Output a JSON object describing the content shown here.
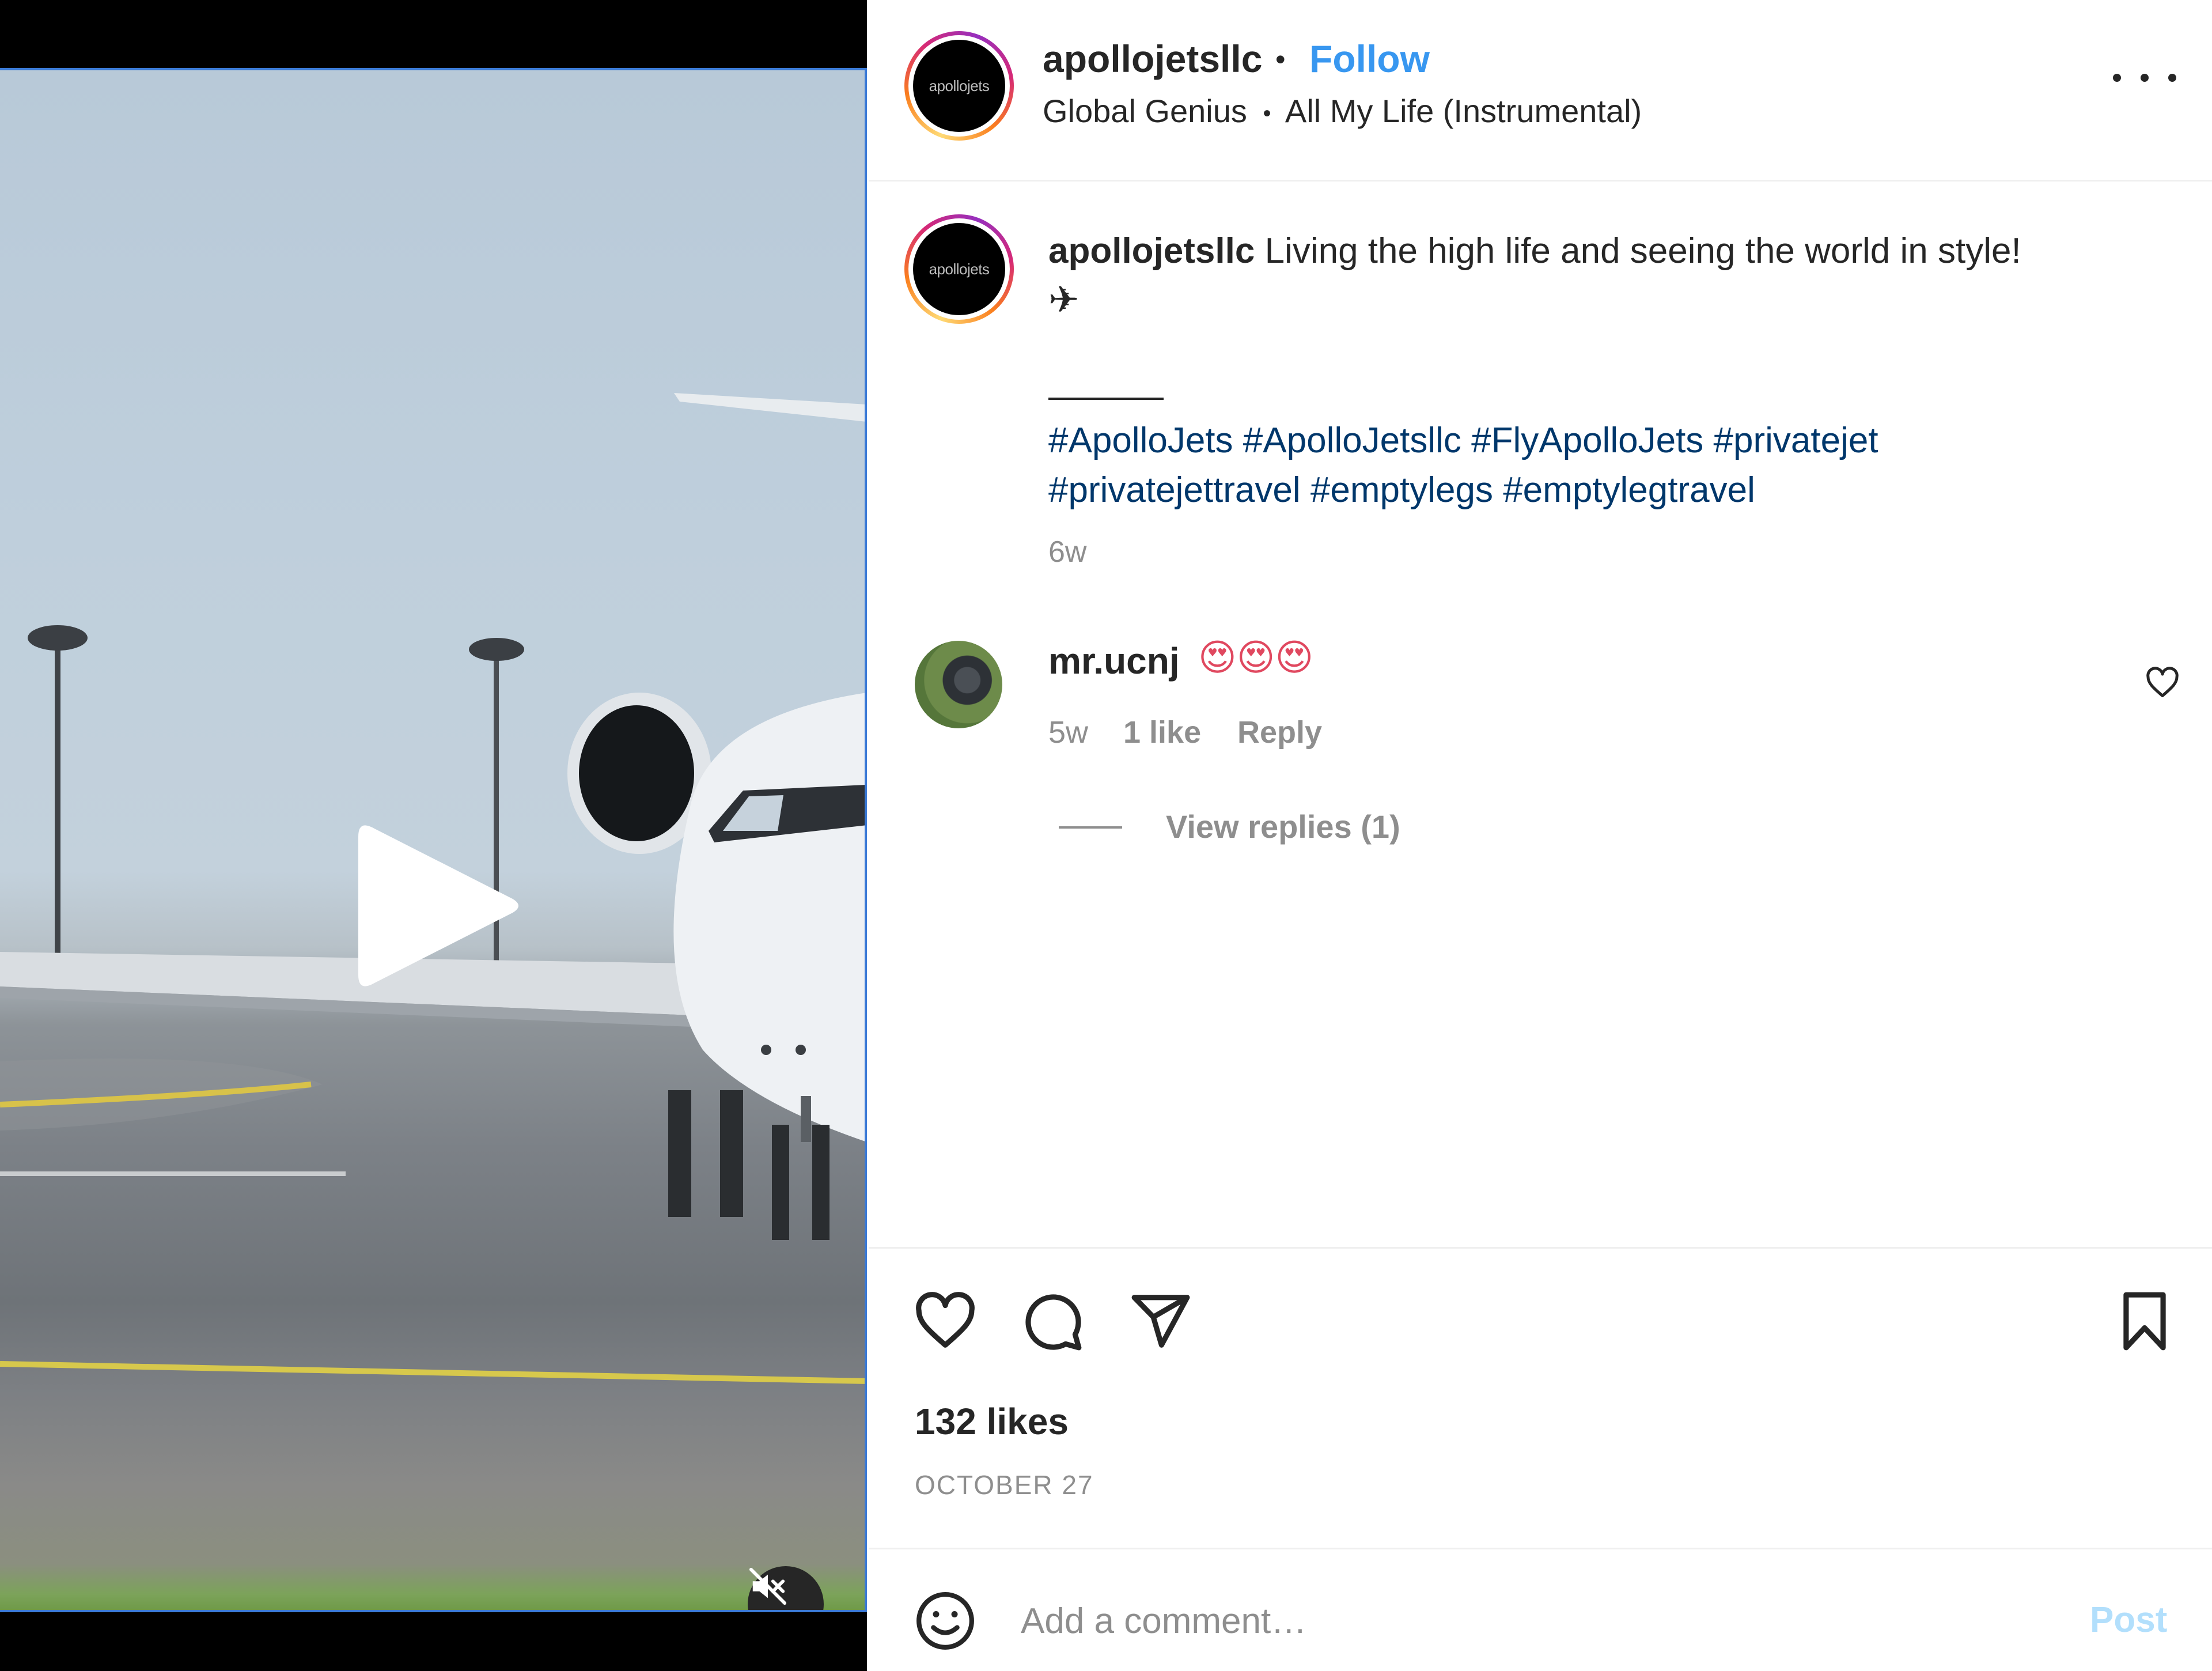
{
  "header": {
    "avatar_text": "apollojets",
    "username": "apollojetsllc",
    "separator": "•",
    "follow_label": "Follow",
    "audio_artist": "Global Genius",
    "audio_track": "All My Life (Instrumental)"
  },
  "caption": {
    "username": "apollojetsllc",
    "text": "Living the high life and seeing the world in style!",
    "emoji": "✈",
    "hashtags": [
      "#ApolloJets",
      "#ApolloJetsllc",
      "#FlyApolloJets",
      "#privatejet",
      "#privatejettravel",
      "#emptylegs",
      "#emptylegtravel"
    ],
    "time": "6w"
  },
  "comment": {
    "username": "mr.ucnj",
    "text": "😍😍😍",
    "time": "5w",
    "likes": "1 like",
    "reply_label": "Reply",
    "view_replies": "View replies (1)"
  },
  "actions": {
    "icons": [
      "heart-icon",
      "comment-icon",
      "share-icon",
      "bookmark-icon"
    ]
  },
  "likes": "132 likes",
  "date": "OCTOBER 27",
  "add_comment": {
    "placeholder": "Add a comment…",
    "post_label": "Post"
  },
  "colors": {
    "link_blue": "#3897f0",
    "hashtag_blue": "#00376b",
    "muted_gray": "#8e8e8e",
    "post_disabled": "#b2dffc"
  }
}
